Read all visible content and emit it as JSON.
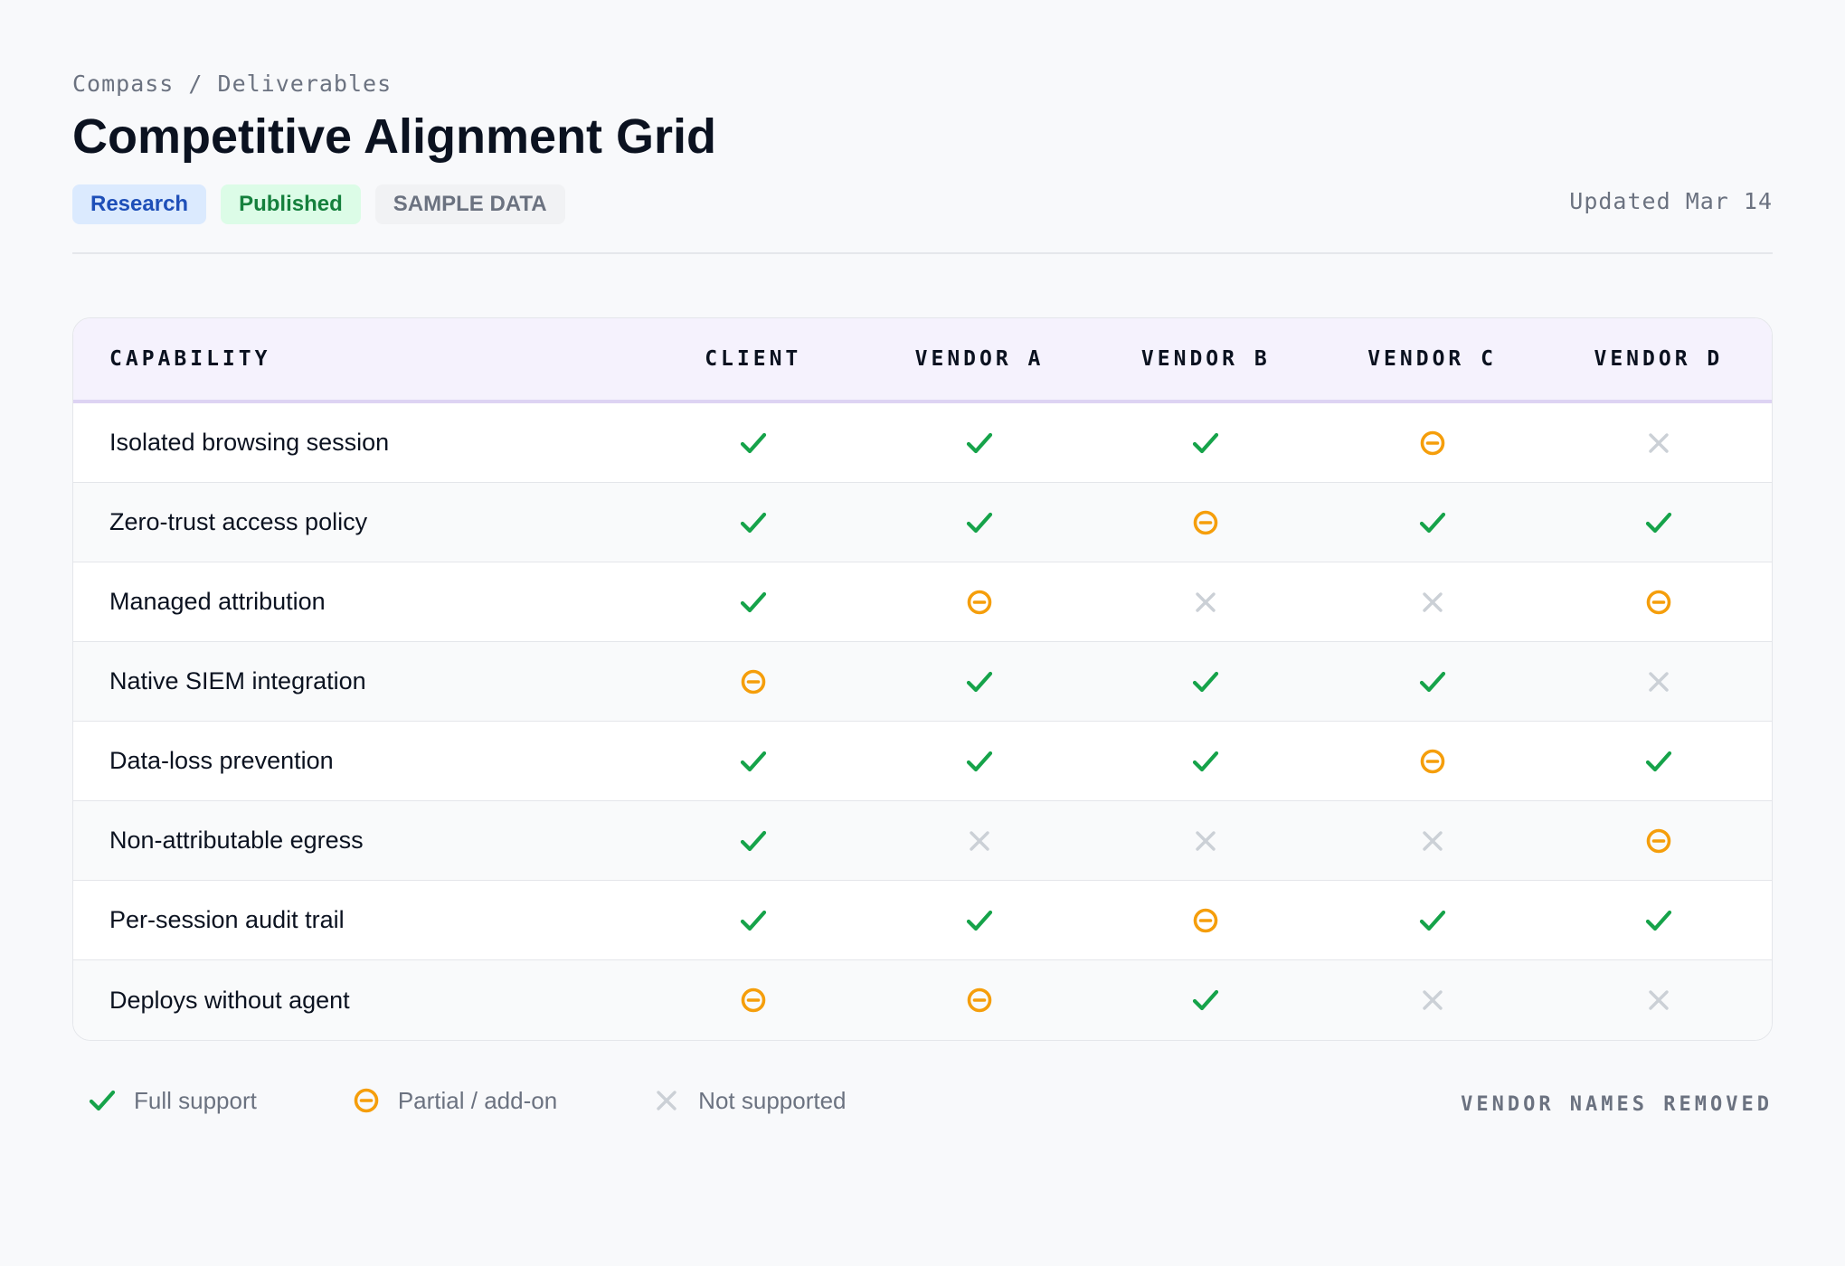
{
  "breadcrumb": "Compass / Deliverables",
  "title": "Competitive Alignment Grid",
  "tags": {
    "research": "Research",
    "published": "Published",
    "sample": "SAMPLE DATA"
  },
  "updated": "Updated Mar 14",
  "colors": {
    "full": "#16a34a",
    "partial": "#f59e0b",
    "none": "#cbd0d6"
  },
  "grid": {
    "headers": [
      "CAPABILITY",
      "CLIENT",
      "VENDOR A",
      "VENDOR B",
      "VENDOR C",
      "VENDOR D"
    ],
    "rows": [
      {
        "capability": "Isolated browsing session",
        "values": [
          "full",
          "full",
          "full",
          "partial",
          "none"
        ]
      },
      {
        "capability": "Zero-trust access policy",
        "values": [
          "full",
          "full",
          "partial",
          "full",
          "full"
        ]
      },
      {
        "capability": "Managed attribution",
        "values": [
          "full",
          "partial",
          "none",
          "none",
          "partial"
        ]
      },
      {
        "capability": "Native SIEM integration",
        "values": [
          "partial",
          "full",
          "full",
          "full",
          "none"
        ]
      },
      {
        "capability": "Data-loss prevention",
        "values": [
          "full",
          "full",
          "full",
          "partial",
          "full"
        ]
      },
      {
        "capability": "Non-attributable egress",
        "values": [
          "full",
          "none",
          "none",
          "none",
          "partial"
        ]
      },
      {
        "capability": "Per-session audit trail",
        "values": [
          "full",
          "full",
          "partial",
          "full",
          "full"
        ]
      },
      {
        "capability": "Deploys without agent",
        "values": [
          "partial",
          "partial",
          "full",
          "none",
          "none"
        ]
      }
    ]
  },
  "legend": {
    "full": "Full support",
    "partial": "Partial / add-on",
    "none": "Not supported"
  },
  "footnote": "VENDOR NAMES REMOVED"
}
